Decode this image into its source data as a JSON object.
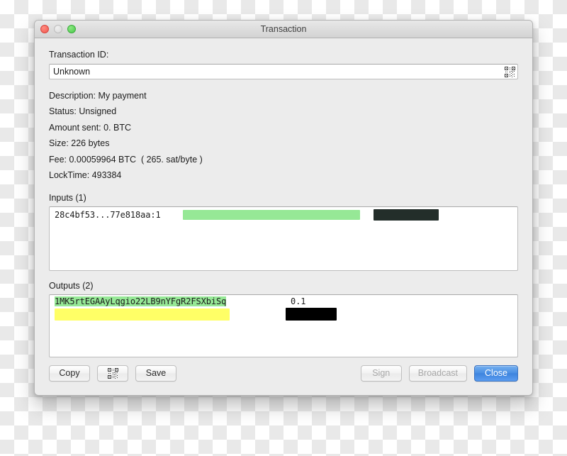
{
  "window": {
    "title": "Transaction",
    "traffic_lights": [
      "close-light",
      "minimize-light",
      "zoom-light"
    ]
  },
  "transaction_id": {
    "label": "Transaction ID:",
    "value": "Unknown",
    "qr_icon": "qr-code-icon"
  },
  "details": [
    "Description: My payment",
    "Status: Unsigned",
    "Amount sent: 0. BTC",
    "Size: 226 bytes",
    "Fee: 0.00059964 BTC  ( 265. sat/byte )",
    "LockTime: 493384"
  ],
  "inputs": {
    "label": "Inputs (1)",
    "rows": [
      {
        "outpoint": "28c4bf53...77e818aa:1",
        "redactions": [
          "green-bar",
          "dark-bar"
        ]
      }
    ]
  },
  "outputs": {
    "label": "Outputs (2)",
    "rows": [
      {
        "address": "1MK5rtEGAAyLqgio22LB9nYFgR2FSXbiSq",
        "highlight": "#96e896",
        "amount": "0.1"
      },
      {
        "address": "",
        "highlight": "#ffff66",
        "amount": "",
        "redactions": [
          "yellow-bar",
          "black-bar"
        ]
      }
    ]
  },
  "buttons": {
    "copy": "Copy",
    "qr": "qr-code-icon",
    "save": "Save",
    "sign": "Sign",
    "broadcast": "Broadcast",
    "close": "Close"
  },
  "colors": {
    "accent": "#4a8fe3",
    "highlight_green": "#96e896",
    "highlight_yellow": "#ffff66",
    "redact_dark": "#232e2a",
    "redact_black": "#000000"
  }
}
